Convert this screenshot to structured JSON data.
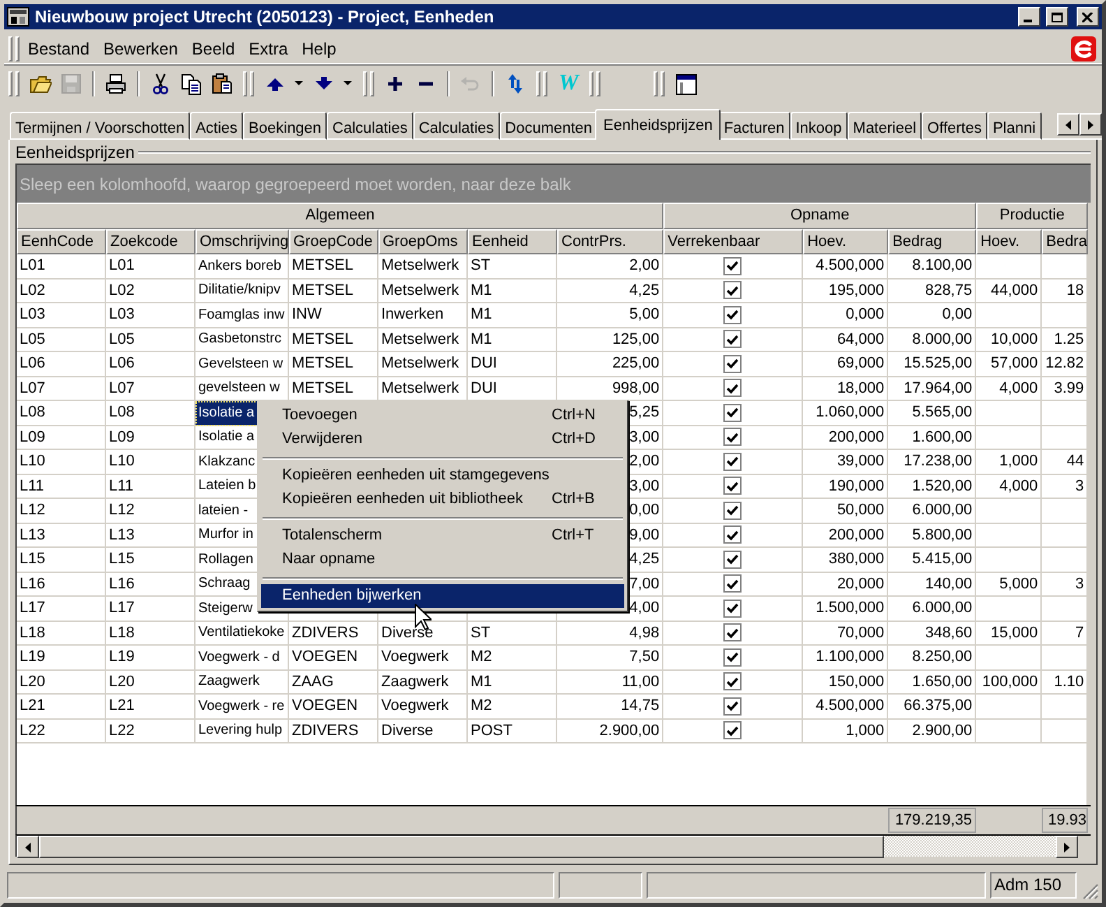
{
  "window": {
    "title": "Nieuwbouw project Utrecht (2050123) - Project, Eenheden"
  },
  "menu_bar": [
    "Bestand",
    "Bewerken",
    "Beeld",
    "Extra",
    "Help"
  ],
  "toolbar": {
    "groups": [
      {
        "items": [
          {
            "kind": "open",
            "disabled": false
          },
          {
            "kind": "save",
            "disabled": true
          },
          {
            "kind": "separator"
          },
          {
            "kind": "print",
            "disabled": false
          },
          {
            "kind": "separator"
          },
          {
            "kind": "cut",
            "disabled": false
          },
          {
            "kind": "copy",
            "disabled": false
          },
          {
            "kind": "paste",
            "disabled": false
          }
        ]
      },
      {
        "items": [
          {
            "kind": "up",
            "disabled": false
          },
          {
            "kind": "dropdown",
            "disabled": false
          },
          {
            "kind": "down",
            "disabled": false
          },
          {
            "kind": "dropdown",
            "disabled": false
          }
        ]
      },
      {
        "items": [
          {
            "kind": "plus",
            "disabled": false
          },
          {
            "kind": "minus",
            "disabled": false
          },
          {
            "kind": "separator"
          },
          {
            "kind": "undo",
            "disabled": true
          },
          {
            "kind": "separator"
          },
          {
            "kind": "refresh",
            "disabled": false
          }
        ]
      },
      {
        "items": [
          {
            "kind": "text",
            "label": "W",
            "disabled": false
          }
        ]
      },
      {
        "items": [
          {
            "kind": "blank"
          }
        ]
      },
      {
        "items": [
          {
            "kind": "window",
            "disabled": false
          }
        ]
      }
    ]
  },
  "tabs": [
    {
      "label": "Termijnen / Voorschotten",
      "selected": false
    },
    {
      "label": "Acties",
      "selected": false
    },
    {
      "label": "Boekingen",
      "selected": false
    },
    {
      "label": "Calculaties",
      "selected": false
    },
    {
      "label": "Calculaties",
      "selected": false
    },
    {
      "label": "Documenten",
      "selected": false
    },
    {
      "label": "Eenheidsprijzen",
      "selected": true
    },
    {
      "label": "Facturen",
      "selected": false
    },
    {
      "label": "Inkoop",
      "selected": false
    },
    {
      "label": "Materieel",
      "selected": false
    },
    {
      "label": "Offertes",
      "selected": false
    },
    {
      "label": "Planni",
      "selected": false
    }
  ],
  "group_box": {
    "label": "Eenheidsprijzen"
  },
  "group_by_panel": {
    "hint": "Sleep een kolomhoofd, waarop gegroepeerd moet worden, naar deze balk"
  },
  "table": {
    "column_groups": [
      {
        "label": "Algemeen",
        "columns": [
          "EenhCode",
          "Zoekcode",
          "Omschrijving",
          "GroepCode",
          "GroepOms",
          "Eenheid",
          "ContrPrs."
        ]
      },
      {
        "label": "Opname",
        "columns": [
          "Verrekenbaar",
          "Hoev.",
          "Bedrag"
        ]
      },
      {
        "label": "Productie",
        "columns": [
          "Hoev.",
          "Bedra"
        ]
      }
    ],
    "rows": [
      {
        "eenhcode": "L01",
        "zoekcode": "L01",
        "omschrijving": "Ankers boreb",
        "groepcode": "METSEL",
        "groepoms": "Metselwerk",
        "eenheid": "ST",
        "contrprs": "2,00",
        "verrekenbaar": true,
        "opname_hoev": "4.500,000",
        "opname_bedrag": "8.100,00",
        "selected": false
      },
      {
        "eenhcode": "L02",
        "zoekcode": "L02",
        "omschrijving": "Dilitatie/knipv",
        "groepcode": "METSEL",
        "groepoms": "Metselwerk",
        "eenheid": "M1",
        "contrprs": "4,25",
        "verrekenbaar": true,
        "opname_hoev": "195,000",
        "opname_bedrag": "828,75",
        "productie_hoev": "44,000",
        "productie_bedrag": "18",
        "selected": false
      },
      {
        "eenhcode": "L03",
        "zoekcode": "L03",
        "omschrijving": "Foamglas inw",
        "groepcode": "INW",
        "groepoms": "Inwerken",
        "eenheid": "M1",
        "contrprs": "5,00",
        "verrekenbaar": true,
        "opname_hoev": "0,000",
        "opname_bedrag": "0,00",
        "selected": false
      },
      {
        "eenhcode": "L05",
        "zoekcode": "L05",
        "omschrijving": "Gasbetonstrc",
        "groepcode": "METSEL",
        "groepoms": "Metselwerk",
        "eenheid": "M1",
        "contrprs": "125,00",
        "verrekenbaar": true,
        "opname_hoev": "64,000",
        "opname_bedrag": "8.000,00",
        "productie_hoev": "10,000",
        "productie_bedrag": "1.25",
        "selected": false
      },
      {
        "eenhcode": "L06",
        "zoekcode": "L06",
        "omschrijving": "Gevelsteen w",
        "groepcode": "METSEL",
        "groepoms": "Metselwerk",
        "eenheid": "DUI",
        "contrprs": "225,00",
        "verrekenbaar": true,
        "opname_hoev": "69,000",
        "opname_bedrag": "15.525,00",
        "productie_hoev": "57,000",
        "productie_bedrag": "12.82",
        "selected": false
      },
      {
        "eenhcode": "L07",
        "zoekcode": "L07",
        "omschrijving": "gevelsteen w",
        "groepcode": "METSEL",
        "groepoms": "Metselwerk",
        "eenheid": "DUI",
        "contrprs": "998,00",
        "verrekenbaar": true,
        "opname_hoev": "18,000",
        "opname_bedrag": "17.964,00",
        "productie_hoev": "4,000",
        "productie_bedrag": "3.99",
        "selected": false
      },
      {
        "eenhcode": "L08",
        "zoekcode": "L08",
        "omschrijving": "Isolatie a",
        "contrprs": "5,25",
        "verrekenbaar": true,
        "opname_hoev": "1.060,000",
        "opname_bedrag": "5.565,00",
        "selected": true
      },
      {
        "eenhcode": "L09",
        "zoekcode": "L09",
        "omschrijving": "Isolatie a",
        "contrprs": "3,00",
        "verrekenbaar": true,
        "opname_hoev": "200,000",
        "opname_bedrag": "1.600,00",
        "selected": false
      },
      {
        "eenhcode": "L10",
        "zoekcode": "L10",
        "omschrijving": "Klakzanc",
        "contrprs": "2,00",
        "verrekenbaar": true,
        "opname_hoev": "39,000",
        "opname_bedrag": "17.238,00",
        "productie_hoev": "1,000",
        "productie_bedrag": "44",
        "selected": false
      },
      {
        "eenhcode": "L11",
        "zoekcode": "L11",
        "omschrijving": "Lateien b",
        "contrprs": "3,00",
        "verrekenbaar": true,
        "opname_hoev": "190,000",
        "opname_bedrag": "1.520,00",
        "productie_hoev": "4,000",
        "productie_bedrag": "3",
        "selected": false
      },
      {
        "eenhcode": "L12",
        "zoekcode": "L12",
        "omschrijving": "lateien -",
        "contrprs": "0,00",
        "verrekenbaar": true,
        "opname_hoev": "50,000",
        "opname_bedrag": "6.000,00",
        "selected": false
      },
      {
        "eenhcode": "L13",
        "zoekcode": "L13",
        "omschrijving": "Murfor in",
        "contrprs": "9,00",
        "verrekenbaar": true,
        "opname_hoev": "200,000",
        "opname_bedrag": "5.800,00",
        "selected": false
      },
      {
        "eenhcode": "L15",
        "zoekcode": "L15",
        "omschrijving": "Rollagen",
        "contrprs": "4,25",
        "verrekenbaar": true,
        "opname_hoev": "380,000",
        "opname_bedrag": "5.415,00",
        "selected": false
      },
      {
        "eenhcode": "L16",
        "zoekcode": "L16",
        "omschrijving": "Schraag",
        "contrprs": "7,00",
        "verrekenbaar": true,
        "opname_hoev": "20,000",
        "opname_bedrag": "140,00",
        "productie_hoev": "5,000",
        "productie_bedrag": "3",
        "selected": false
      },
      {
        "eenhcode": "L17",
        "zoekcode": "L17",
        "omschrijving": "Steigerw",
        "contrprs": "4,00",
        "verrekenbaar": true,
        "opname_hoev": "1.500,000",
        "opname_bedrag": "6.000,00",
        "selected": false
      },
      {
        "eenhcode": "L18",
        "zoekcode": "L18",
        "omschrijving": "Ventilatiekoke",
        "groepcode": "ZDIVERS",
        "groepoms": "Diverse",
        "eenheid": "ST",
        "contrprs": "4,98",
        "verrekenbaar": true,
        "opname_hoev": "70,000",
        "opname_bedrag": "348,60",
        "productie_hoev": "15,000",
        "productie_bedrag": "7",
        "selected": false
      },
      {
        "eenhcode": "L19",
        "zoekcode": "L19",
        "omschrijving": "Voegwerk - d",
        "groepcode": "VOEGEN",
        "groepoms": "Voegwerk",
        "eenheid": "M2",
        "contrprs": "7,50",
        "verrekenbaar": true,
        "opname_hoev": "1.100,000",
        "opname_bedrag": "8.250,00",
        "selected": false
      },
      {
        "eenhcode": "L20",
        "zoekcode": "L20",
        "omschrijving": "Zaagwerk",
        "groepcode": "ZAAG",
        "groepoms": "Zaagwerk",
        "eenheid": "M1",
        "contrprs": "11,00",
        "verrekenbaar": true,
        "opname_hoev": "150,000",
        "opname_bedrag": "1.650,00",
        "productie_hoev": "100,000",
        "productie_bedrag": "1.10",
        "selected": false
      },
      {
        "eenhcode": "L21",
        "zoekcode": "L21",
        "omschrijving": "Voegwerk - re",
        "groepcode": "VOEGEN",
        "groepoms": "Voegwerk",
        "eenheid": "M2",
        "contrprs": "14,75",
        "verrekenbaar": true,
        "opname_hoev": "4.500,000",
        "opname_bedrag": "66.375,00",
        "selected": false
      },
      {
        "eenhcode": "L22",
        "zoekcode": "L22",
        "omschrijving": "Levering hulp",
        "groepcode": "ZDIVERS",
        "groepoms": "Diverse",
        "eenheid": "POST",
        "contrprs": "2.900,00",
        "verrekenbaar": true,
        "opname_hoev": "1,000",
        "opname_bedrag": "2.900,00",
        "selected": false
      }
    ],
    "totals": {
      "opname_bedrag": "179.219,35",
      "productie_bedrag": "19.93"
    }
  },
  "context_menu": {
    "items": [
      {
        "kind": "item",
        "label": "Toevoegen",
        "shortcut": "Ctrl+N",
        "selected": false
      },
      {
        "kind": "item",
        "label": "Verwijderen",
        "shortcut": "Ctrl+D",
        "selected": false
      },
      {
        "kind": "separator"
      },
      {
        "kind": "item",
        "label": "Kopieëren eenheden uit stamgegevens",
        "selected": false
      },
      {
        "kind": "item",
        "label": "Kopieëren eenheden uit bibliotheek",
        "shortcut": "Ctrl+B",
        "selected": false
      },
      {
        "kind": "separator"
      },
      {
        "kind": "item",
        "label": "Totalenscherm",
        "shortcut": "Ctrl+T",
        "selected": false
      },
      {
        "kind": "item",
        "label": "Naar opname",
        "selected": false
      },
      {
        "kind": "separator"
      },
      {
        "kind": "item",
        "label": "Eenheden bijwerken",
        "selected": true
      }
    ]
  },
  "status_bar": {
    "user": "Adm 150"
  }
}
